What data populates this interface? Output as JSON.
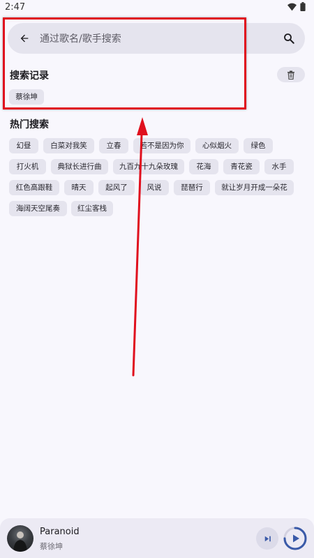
{
  "status_bar": {
    "time": "2:47"
  },
  "search": {
    "placeholder": "通过歌名/歌手搜索",
    "value": ""
  },
  "history": {
    "title": "搜索记录",
    "items": [
      "蔡徐坤"
    ]
  },
  "hot": {
    "title": "热门搜索",
    "items": [
      "幻昼",
      "白菜对我笑",
      "立春",
      "若不是因为你",
      "心似烟火",
      "绿色",
      "打火机",
      "典狱长进行曲",
      "九百九十九朵玫瑰",
      "花海",
      "青花瓷",
      "水手",
      "红色高跟鞋",
      "晴天",
      "起风了",
      "风说",
      "琵琶行",
      "就让岁月开成一朵花",
      "海阔天空尾奏",
      "红尘客栈"
    ]
  },
  "player": {
    "title": "Paranoid",
    "artist": "蔡徐坤",
    "progress": 0.75
  },
  "colors": {
    "accent": "#3a5aa8",
    "annotation": "#e0101e",
    "chip_bg": "#e5e4ee",
    "background": "#f8f7fd"
  },
  "icons": [
    "wifi-icon",
    "battery-icon",
    "back-arrow-icon",
    "search-icon",
    "trash-icon",
    "skip-next-icon",
    "play-icon"
  ]
}
